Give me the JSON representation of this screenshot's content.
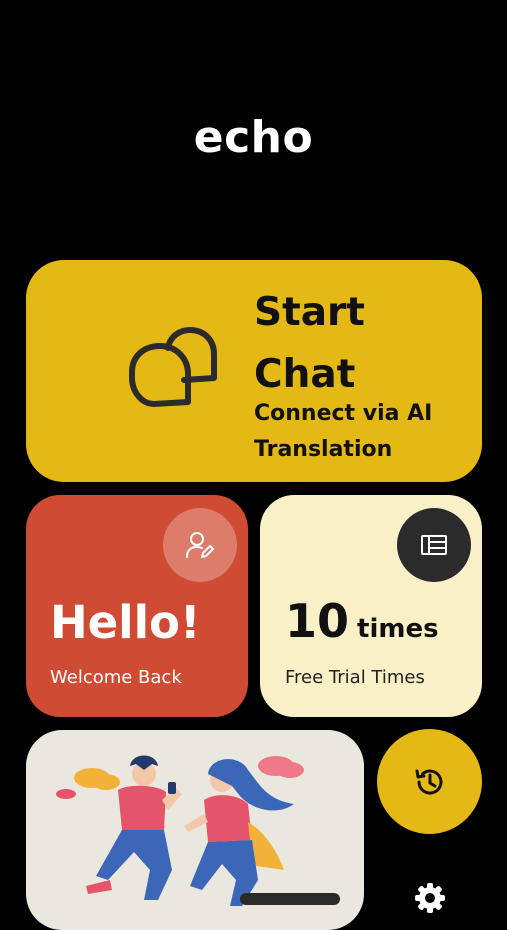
{
  "app": {
    "title": "echo"
  },
  "start_chat": {
    "title_line1": "Start",
    "title_line2": "Chat",
    "subtitle": "Connect via AI Translation",
    "icon": "chat-bubbles-icon"
  },
  "hello_card": {
    "title": "Hello!",
    "subtitle": "Welcome Back",
    "icon": "edit-profile-icon"
  },
  "trial_card": {
    "count": "10",
    "unit": "times",
    "subtitle": "Free Trial Times",
    "icon": "stack-icon"
  },
  "illustration": {
    "icon": "chatting-people-illustration"
  },
  "history_button": {
    "icon": "history-icon"
  },
  "settings_button": {
    "icon": "gear-icon"
  },
  "colors": {
    "background": "#000000",
    "yellow": "#E4B916",
    "red": "#CF4B34",
    "cream": "#F9F0C8"
  }
}
